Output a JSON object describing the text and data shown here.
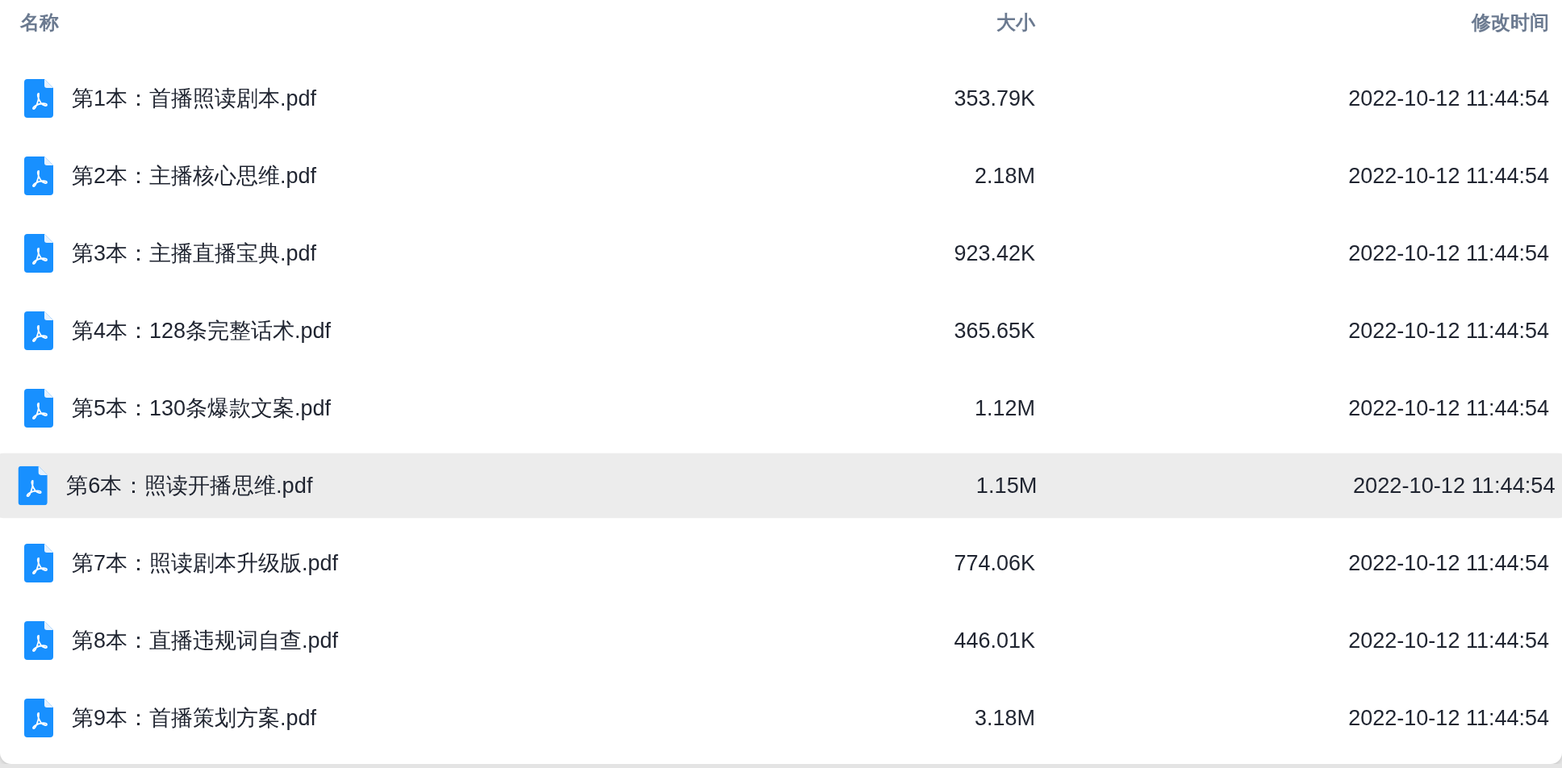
{
  "table": {
    "columns": [
      {
        "label": "名称"
      },
      {
        "label": "大小"
      },
      {
        "label": "修改时间"
      }
    ],
    "rows": [
      {
        "name": "第1本：首播照读剧本.pdf",
        "size": "353.79K",
        "modified": "2022-10-12 11:44:54",
        "selected": false
      },
      {
        "name": "第2本：主播核心思维.pdf",
        "size": "2.18M",
        "modified": "2022-10-12 11:44:54",
        "selected": false
      },
      {
        "name": "第3本：主播直播宝典.pdf",
        "size": "923.42K",
        "modified": "2022-10-12 11:44:54",
        "selected": false
      },
      {
        "name": "第4本：128条完整话术.pdf",
        "size": "365.65K",
        "modified": "2022-10-12 11:44:54",
        "selected": false
      },
      {
        "name": "第5本：130条爆款文案.pdf",
        "size": "1.12M",
        "modified": "2022-10-12 11:44:54",
        "selected": false
      },
      {
        "name": "第6本：照读开播思维.pdf",
        "size": "1.15M",
        "modified": "2022-10-12 11:44:54",
        "selected": true
      },
      {
        "name": "第7本：照读剧本升级版.pdf",
        "size": "774.06K",
        "modified": "2022-10-12 11:44:54",
        "selected": false
      },
      {
        "name": "第8本：直播违规词自查.pdf",
        "size": "446.01K",
        "modified": "2022-10-12 11:44:54",
        "selected": false
      },
      {
        "name": "第9本：首播策划方案.pdf",
        "size": "3.18M",
        "modified": "2022-10-12 11:44:54",
        "selected": false
      }
    ]
  }
}
